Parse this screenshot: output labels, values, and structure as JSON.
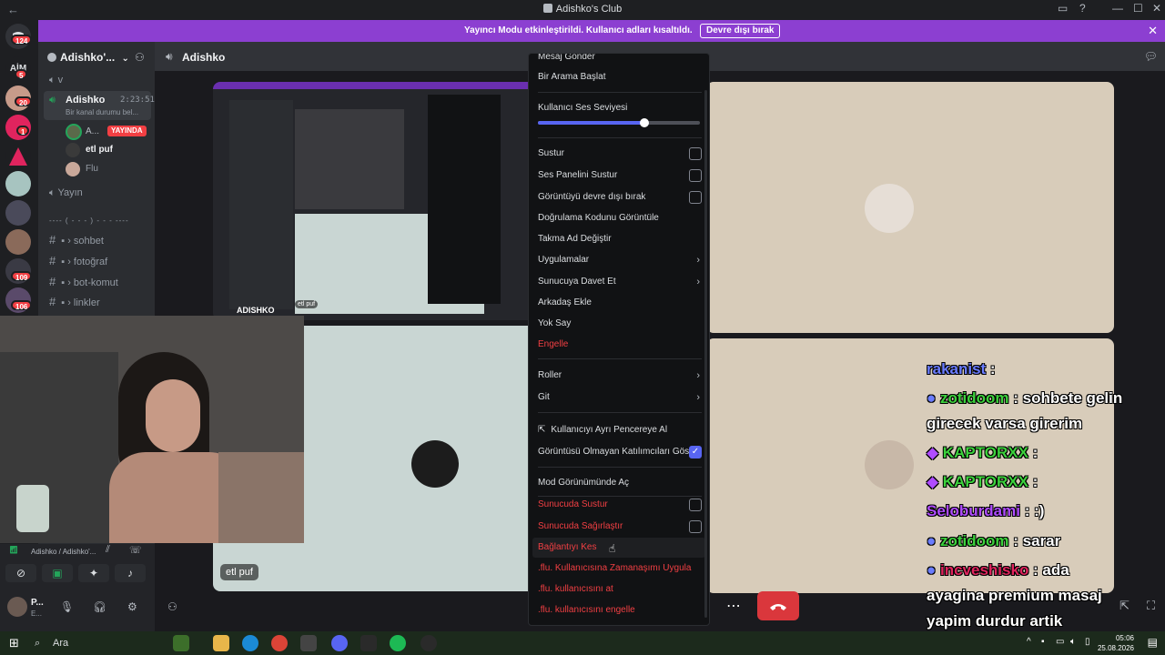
{
  "window": {
    "title": "Adishko's Club",
    "controls": [
      "minimize-icon",
      "maximize-icon",
      "close-icon"
    ]
  },
  "banner": {
    "message": "Yayıncı Modu etkinleştirildi. Kullanıcı adları kısaltıldı.",
    "button_label": "Devre dışı bırak"
  },
  "server_rail": {
    "badges": [
      "124",
      "5",
      "20",
      "1",
      "109",
      "106"
    ],
    "label_aim": "AİM"
  },
  "sidebar": {
    "server_name": "Adishko'...",
    "category_v": "v",
    "voice_channel": {
      "name": "Adishko",
      "timer": "2:23:51",
      "status": "Bir kanal durumu bel...",
      "members": [
        {
          "name": "A...",
          "badge": "YAYINDA"
        },
        {
          "name": "etl puf"
        },
        {
          "name": "Flu"
        }
      ]
    },
    "stream_channel": "Yayın",
    "divider": "---- ( - - - ) - - - ----",
    "text_channels": [
      {
        "name": "sohbet"
      },
      {
        "name": "fotoğraf"
      },
      {
        "name": "bot-komut"
      },
      {
        "name": "linkler"
      }
    ],
    "voice_status_path": "Adishko / Adishko'...",
    "user_name": "P...",
    "user_status": "E..."
  },
  "main": {
    "channel_name": "Adishko",
    "tiles": {
      "etl_puf_label": "etl puf"
    },
    "inner_stream_label": "ADISHKO"
  },
  "context_menu": {
    "items": [
      {
        "label": "Mesaj Gönder",
        "type": "item"
      },
      {
        "label": "Bir Arama Başlat",
        "type": "item"
      },
      {
        "label": "Kullanıcı Ses Seviyesi",
        "type": "slider",
        "value_percent": 66
      },
      {
        "label": "Sustur",
        "type": "checkbox",
        "checked": false
      },
      {
        "label": "Ses Panelini Sustur",
        "type": "checkbox",
        "checked": false
      },
      {
        "label": "Görüntüyü devre dışı bırak",
        "type": "checkbox",
        "checked": false
      },
      {
        "label": "Doğrulama Kodunu Görüntüle",
        "type": "item"
      },
      {
        "label": "Takma Ad Değiştir",
        "type": "item"
      },
      {
        "label": "Uygulamalar",
        "type": "submenu"
      },
      {
        "label": "Sunucuya Davet Et",
        "type": "submenu"
      },
      {
        "label": "Arkadaş Ekle",
        "type": "item"
      },
      {
        "label": "Yok Say",
        "type": "item"
      },
      {
        "label": "Engelle",
        "type": "danger"
      },
      {
        "label": "Roller",
        "type": "submenu"
      },
      {
        "label": "Git",
        "type": "submenu"
      },
      {
        "label": "Kullanıcıyı Ayrı Pencereye Al",
        "type": "item"
      },
      {
        "label": "Görüntüsü Olmayan Katılımcıları Göster",
        "type": "checkbox",
        "checked": true
      },
      {
        "label": "Mod Görünümünde Aç",
        "type": "item"
      },
      {
        "label": "Sunucuda Sustur",
        "type": "danger-checkbox",
        "checked": false
      },
      {
        "label": "Sunucuda Sağırlaştır",
        "type": "danger-checkbox",
        "checked": false
      },
      {
        "label": "Bağlantıyı Kes",
        "type": "danger"
      },
      {
        "label": ".flu. Kullanıcısına Zamanaşımı Uygula",
        "type": "danger"
      },
      {
        "label": ".flu. kullanıcısını at",
        "type": "danger"
      },
      {
        "label": ".flu. kullanıcısını engelle",
        "type": "danger"
      }
    ]
  },
  "chat_overlay": [
    {
      "user": "rakanist",
      "text": " : ",
      "color": "#6a7cff"
    },
    {
      "user": "zotidoom",
      "text": " : sohbete gelin",
      "color": "#3cd13c"
    },
    {
      "user": "",
      "text": "girecek varsa girerim",
      "color": "#ffffff"
    },
    {
      "user": "KAPTORXX",
      "text": " : ",
      "color": "#3cd13c"
    },
    {
      "user": "KAPTORXX",
      "text": " : ",
      "color": "#3cd13c"
    },
    {
      "user": "Seloburdami",
      "text": " : :)",
      "color": "#b04cff"
    },
    {
      "user": "zotidoom",
      "text": " : sarar",
      "color": "#3cd13c"
    },
    {
      "user": "incveshisko",
      "text": " : ada",
      "color": "#e0245e"
    },
    {
      "user": "",
      "text": "ayagina premium masaj",
      "color": "#ffffff"
    },
    {
      "user": "",
      "text": "yapim durdur artik",
      "color": "#ffffff"
    }
  ],
  "taskbar": {
    "search_placeholder": "Ara",
    "time": "05:06",
    "date": "25.08.2026"
  },
  "colors": {
    "banner": "#8c3fd1",
    "danger": "#f23f43",
    "accent": "#5865f2",
    "live_badge": "#f23f43"
  }
}
